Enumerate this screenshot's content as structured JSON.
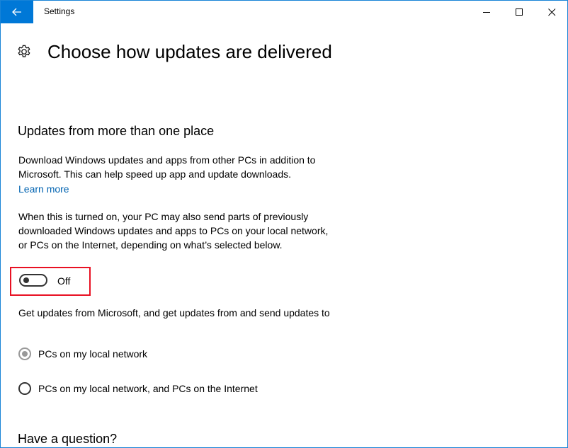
{
  "window": {
    "title": "Settings",
    "accent_color": "#0078d7"
  },
  "titlebar": {
    "back_icon": "arrow-left-icon",
    "minimize_icon": "minimize-icon",
    "maximize_icon": "maximize-icon",
    "close_icon": "close-icon"
  },
  "header": {
    "icon": "gear-icon",
    "title": "Choose how updates are delivered"
  },
  "section_updates": {
    "title": "Updates from more than one place",
    "description": "Download Windows updates and apps from other PCs in addition to Microsoft. This can help speed up app and update downloads.",
    "learn_more": "Learn more",
    "note": "When this is turned on, your PC may also send parts of previously downloaded Windows updates and apps to PCs on your local network, or PCs on the Internet, depending on what’s selected below.",
    "toggle": {
      "state": "Off",
      "on": false,
      "highlight_color": "#e81123"
    },
    "radio_prompt": "Get updates from Microsoft, and get updates from and send updates to",
    "options": [
      {
        "label": "PCs on my local network",
        "selected": true
      },
      {
        "label": "PCs on my local network, and PCs on the Internet",
        "selected": false
      }
    ]
  },
  "section_question": {
    "title": "Have a question?"
  }
}
